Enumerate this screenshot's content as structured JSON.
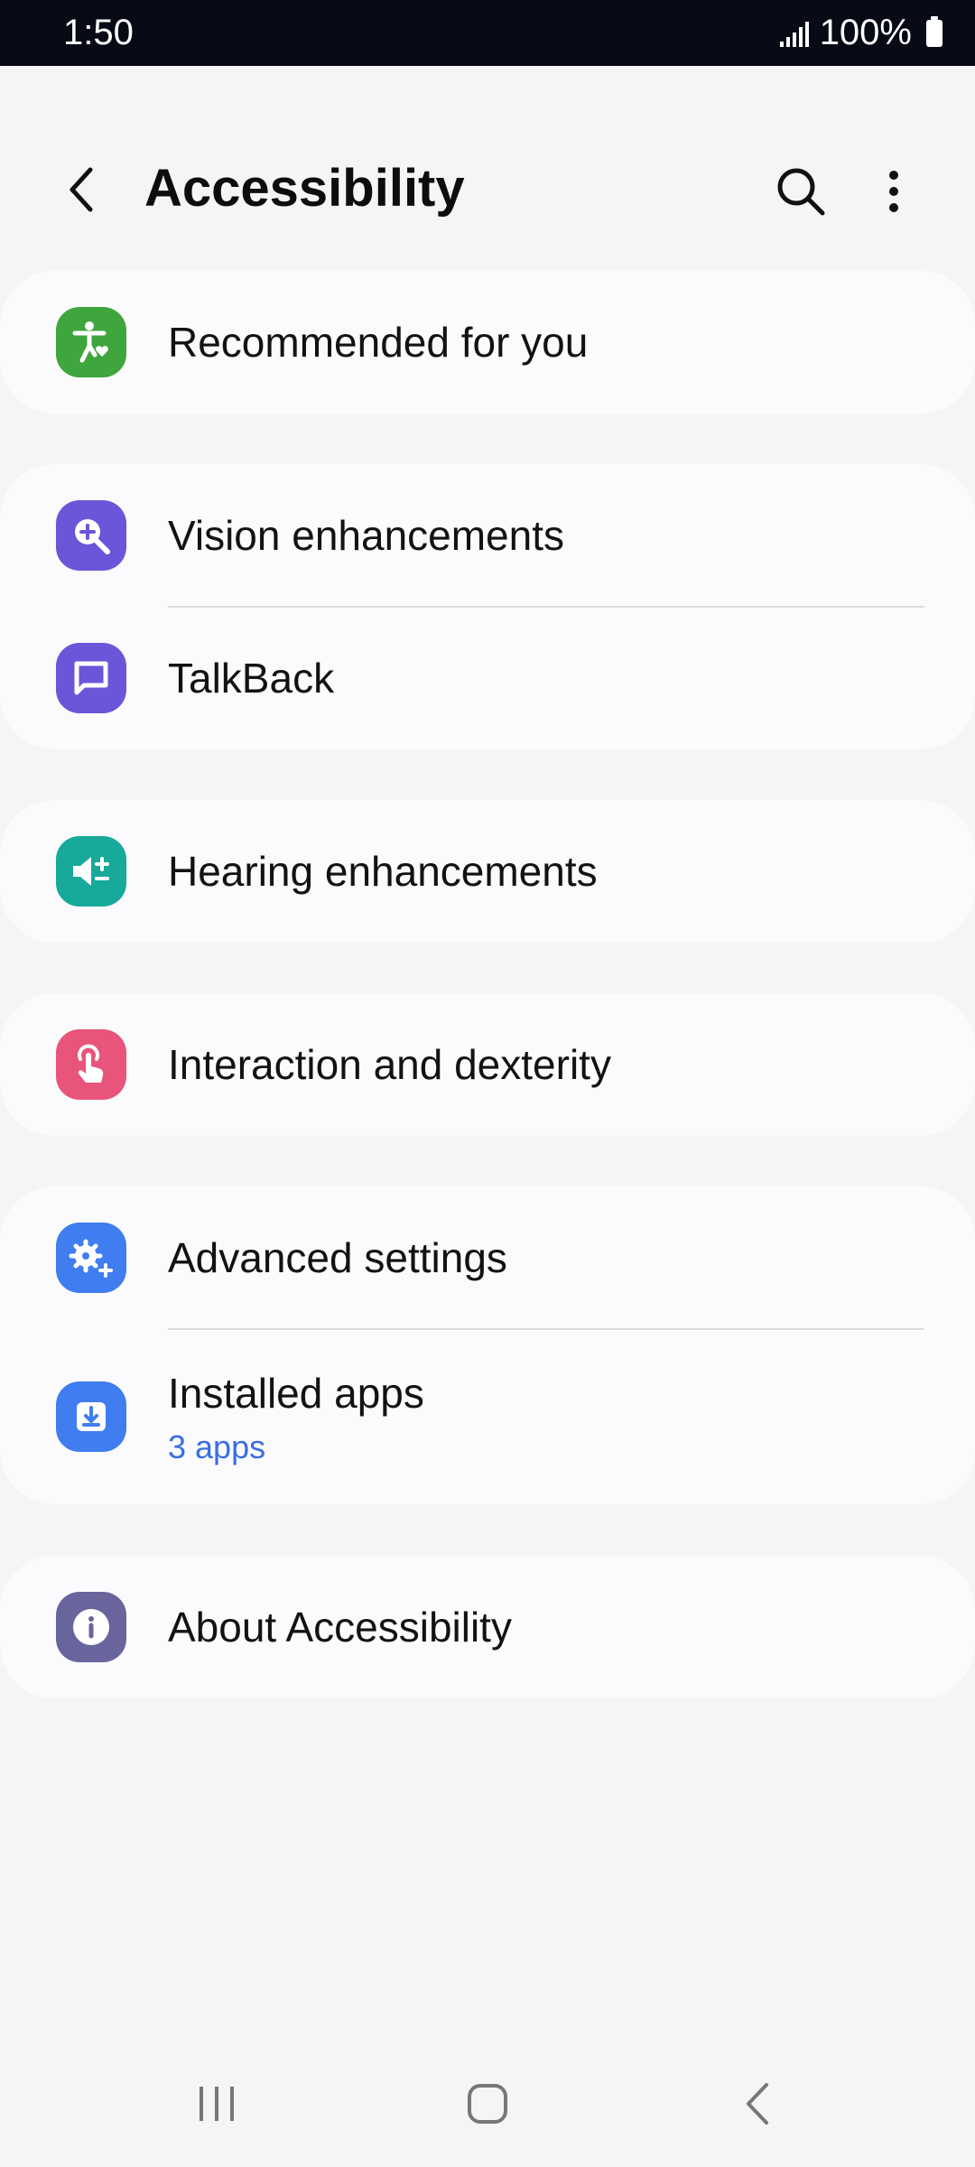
{
  "status_bar": {
    "time": "1:50",
    "battery": "100%"
  },
  "header": {
    "title": "Accessibility"
  },
  "items": {
    "recommended": {
      "label": "Recommended for you",
      "color": "#3fa53d"
    },
    "vision": {
      "label": "Vision enhancements",
      "color": "#6a56d8"
    },
    "talkback": {
      "label": "TalkBack",
      "color": "#6a56d8"
    },
    "hearing": {
      "label": "Hearing enhancements",
      "color": "#17a99a"
    },
    "interaction": {
      "label": "Interaction and dexterity",
      "color": "#e9547a"
    },
    "advanced": {
      "label": "Advanced settings",
      "color": "#3f7df0"
    },
    "installed": {
      "label": "Installed apps",
      "sublabel": "3 apps",
      "color": "#3f7df0"
    },
    "about": {
      "label": "About Accessibility",
      "color": "#68659c"
    }
  },
  "icons": {
    "recommended": "accessibility-person-icon",
    "vision": "magnifier-plus-icon",
    "talkback": "speech-bubble-icon",
    "hearing": "speaker-plus-minus-icon",
    "interaction": "touch-hand-icon",
    "advanced": "gears-plus-icon",
    "installed": "download-icon",
    "about": "info-icon"
  }
}
